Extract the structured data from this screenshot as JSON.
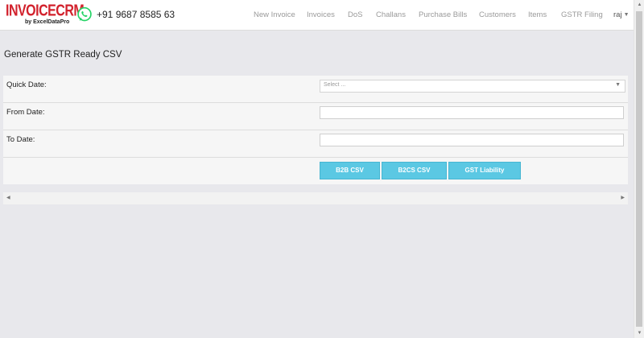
{
  "header": {
    "logo_main": "INVOICECRM",
    "logo_sub": "by ExcelDataPro",
    "phone": "+91 9687 8585 63",
    "nav": [
      "New Invoice",
      "Invoices",
      "DoS",
      "Challans",
      "Purchase Bills",
      "Customers",
      "Items",
      "GSTR Filing"
    ],
    "user": "raj"
  },
  "page": {
    "title": "Generate GSTR Ready CSV"
  },
  "form": {
    "quick_date_label": "Quick Date:",
    "quick_date_placeholder": "Select ...",
    "from_date_label": "From Date:",
    "from_date_value": "",
    "to_date_label": "To Date:",
    "to_date_value": ""
  },
  "buttons": {
    "b2b": "B2B CSV",
    "b2cs": "B2CS CSV",
    "gst": "GST Liability"
  },
  "colors": {
    "logo_red": "#d2222d",
    "whatsapp_green": "#25d366",
    "button_cyan": "#5bc8e3"
  },
  "icons": {
    "whatsapp": "whatsapp-icon",
    "dropdown": "chevron-down-icon"
  }
}
